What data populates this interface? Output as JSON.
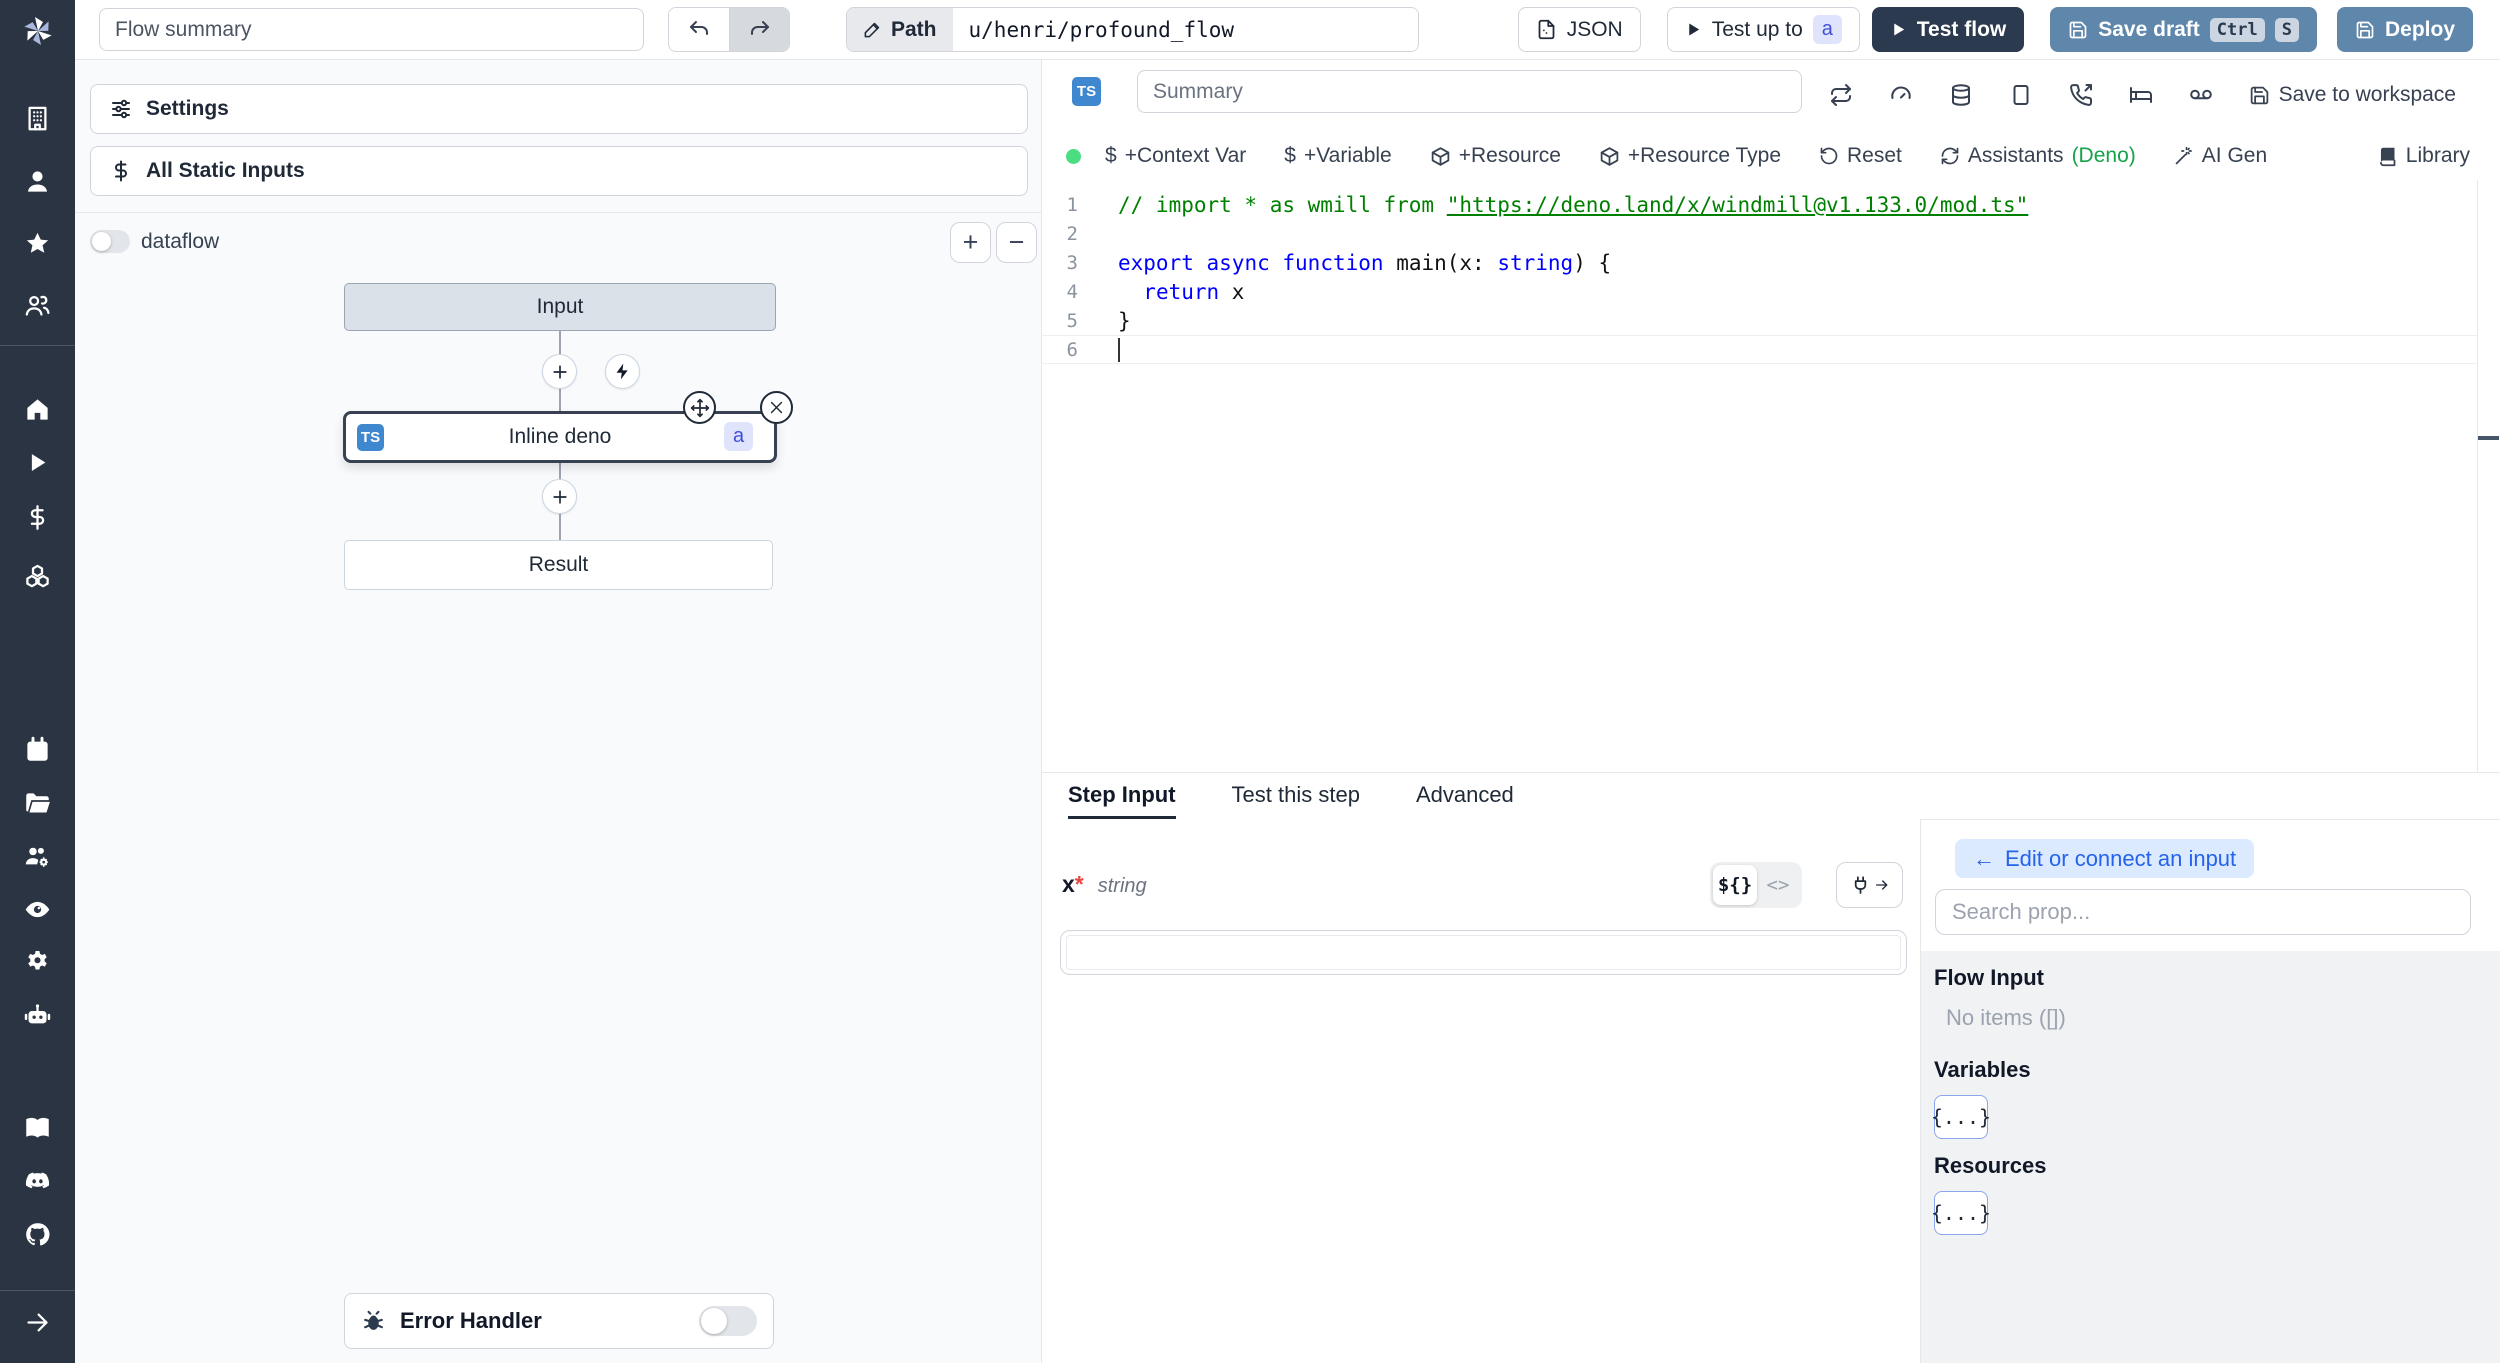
{
  "topbar": {
    "flow_summary_placeholder": "Flow summary",
    "path": {
      "label": "Path",
      "value": "u/henri/profound_flow"
    },
    "json_button_label": "JSON",
    "test_up_to_label": "Test up to",
    "test_up_to_badge": "a",
    "test_flow_label": "Test flow",
    "save_draft_label": "Save draft",
    "save_draft_shortcut": [
      "Ctrl",
      "S"
    ],
    "deploy_label": "Deploy"
  },
  "sidebar": {
    "icons": [
      "windmill-logo",
      "building-icon",
      "user-icon",
      "star-icon",
      "users-icon",
      "home-icon",
      "play-icon",
      "dollar-icon",
      "boxes-icon",
      "calendar-icon",
      "folder-open-icon",
      "workers-icon",
      "eye-icon",
      "gear-icon",
      "robot-icon",
      "book-open-icon",
      "discord-icon",
      "github-icon",
      "arrow-right-icon"
    ]
  },
  "flow_panel": {
    "settings_label": "Settings",
    "all_static_inputs_label": "All Static Inputs",
    "dataflow_toggle": {
      "label": "dataflow",
      "state": "off"
    },
    "zoom_in": "+",
    "zoom_out": "−",
    "graph": {
      "input_node": "Input",
      "step_node": {
        "language_badge": "TS",
        "label": "Inline deno",
        "id_badge": "a",
        "selected": true
      },
      "result_node": "Result"
    },
    "error_handler": {
      "label": "Error Handler",
      "state": "off"
    }
  },
  "editor": {
    "language_badge": "TS",
    "summary_placeholder": "Summary",
    "status_dot_color": "#4ade80",
    "save_to_workspace_label": "Save to workspace",
    "toolbar": {
      "dollar_glyph": "$",
      "context_var": "+Context Var",
      "variable": "+Variable",
      "resource": "+Resource",
      "resource_type": "+Resource Type",
      "reset": "Reset",
      "assistants": "Assistants",
      "assistants_lang": "(Deno)",
      "ai_gen": "AI Gen",
      "library": "Library"
    },
    "code": {
      "cursor_line": 6,
      "lines": [
        [
          {
            "t": "// import * as wmill from ",
            "c": "cmt"
          },
          {
            "t": "\"https://deno.land/x/windmill@v1.133.0/mod.ts\"",
            "c": "cmt lnk"
          }
        ],
        [],
        [
          {
            "t": "export",
            "c": "kw"
          },
          {
            "t": " ",
            "c": "pl"
          },
          {
            "t": "async",
            "c": "kw"
          },
          {
            "t": " ",
            "c": "pl"
          },
          {
            "t": "function",
            "c": "kw"
          },
          {
            "t": " main(x: ",
            "c": "pl"
          },
          {
            "t": "string",
            "c": "kw"
          },
          {
            "t": ") {",
            "c": "pl"
          }
        ],
        [
          {
            "t": "  ",
            "c": "pl"
          },
          {
            "t": "return",
            "c": "kw"
          },
          {
            "t": " x",
            "c": "pl"
          }
        ],
        [
          {
            "t": "}",
            "c": "pl"
          }
        ],
        []
      ]
    }
  },
  "tabs": [
    {
      "label": "Step Input",
      "active": true
    },
    {
      "label": "Test this step",
      "active": false
    },
    {
      "label": "Advanced",
      "active": false
    }
  ],
  "step_input": {
    "arg_name": "x",
    "required_mark": "*",
    "arg_type": "string",
    "template_toggle_label": "${}",
    "code_toggle_label": "<>",
    "value": ""
  },
  "connect_panel": {
    "back_arrow": "←",
    "back_button_label": "Edit or connect an input",
    "search_placeholder": "Search prop...",
    "flow_input_title": "Flow Input",
    "flow_input_empty": "No items ([])",
    "variables_title": "Variables",
    "variables_button": "{...}",
    "resources_title": "Resources",
    "resources_button": "{...}"
  },
  "colors": {
    "sidebar_bg": "#2b3442",
    "steel_blue": "#5f87ab",
    "dark_navy": "#2b3a4e",
    "ts_badge_blue": "#3f87cf",
    "id_badge_bg": "#dfe4fc",
    "id_badge_text": "#3f4fd8",
    "accent_blue": "#2563eb",
    "accent_blue_bg": "#dbeafe",
    "deno_green": "#16a34a",
    "status_green": "#4ade80",
    "comment_green": "#008000",
    "keyword_blue": "#0000ff"
  }
}
